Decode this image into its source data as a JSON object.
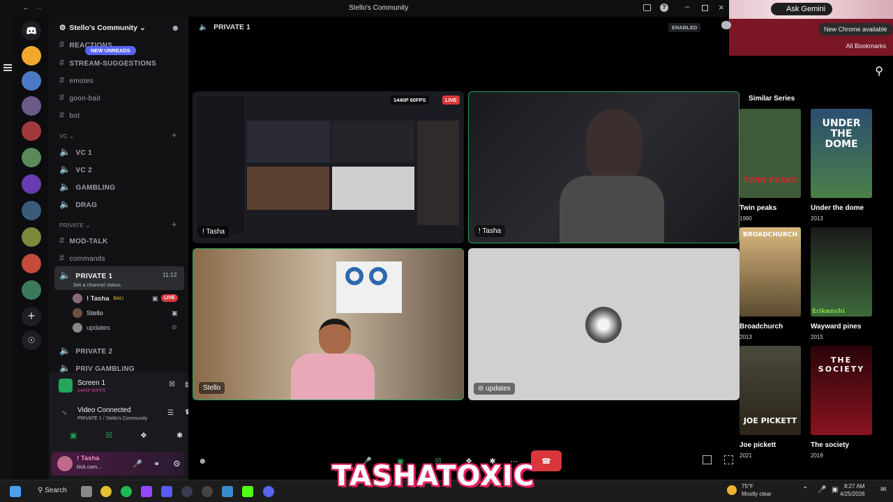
{
  "window": {
    "title": "Stello's Community"
  },
  "server": {
    "name": "Stello's Community",
    "new_unreads": "NEW UNREADS"
  },
  "channels": {
    "top": [
      "REACTIONS",
      "STREAM-SUGGESTIONS",
      "emotes",
      "goon-bait",
      "bot"
    ],
    "vc_category": "VC",
    "vc": [
      "VC 1",
      "VC 2",
      "GAMBLING",
      "DRAG"
    ],
    "private_category": "PRIVATE",
    "private_text": [
      "MOD-TALK",
      "commands"
    ],
    "private1": {
      "name": "PRIVATE 1",
      "time": "11:12",
      "status": "Set a channel status"
    },
    "voice_users": [
      {
        "name": "! Tasha",
        "badge": "BAU",
        "live": "LIVE"
      },
      {
        "name": "Stello"
      },
      {
        "name": "updates"
      }
    ],
    "after": [
      "PRIVATE 2",
      "PRIV GAMBLING"
    ]
  },
  "panel": {
    "screen_title": "Screen 1",
    "screen_sub": "1440P 60FPS",
    "video_connected": "Video Connected",
    "video_sub": "PRIVATE 1 / Stello's Community",
    "user_name": "! Tasha",
    "user_sub": "kick.com..."
  },
  "main": {
    "channel": "PRIVATE 1",
    "enabled": "ENABLED",
    "stream_badge": "1440P 60FPS",
    "live": "LIVE",
    "tiles": {
      "tl": "! Tasha",
      "tr": "! Tasha",
      "bl": "Stello",
      "br": "updates"
    }
  },
  "chrome": {
    "ask_gemini": "Ask Gemini",
    "new_chrome": "New Chrome available",
    "bookmarks": "All Bookmarks",
    "similar": "Similar Series",
    "shows": [
      {
        "name": "Twin peaks",
        "year": "1990",
        "poster": "TWIN PEAKS",
        "color": "#3f5a3a"
      },
      {
        "name": "Under the dome",
        "year": "2013",
        "poster": "UNDER THE DOME",
        "color": "#355b80"
      },
      {
        "name": "Broadchurch",
        "year": "2013",
        "poster": "BROADCHURCH",
        "color": "#c9a56a"
      },
      {
        "name": "Wayward pines",
        "year": "2015",
        "poster": "",
        "color": "#2e4a30"
      },
      {
        "name": "Joe pickett",
        "year": "2021",
        "poster": "JOE PICKETT",
        "color": "#3a3428"
      },
      {
        "name": "The society",
        "year": "2019",
        "poster": "THE SOCIETY",
        "color": "#5a0c12"
      }
    ],
    "watermark": "Erikenshi"
  },
  "taskbar": {
    "search": "Search",
    "weather_temp": "75°F",
    "weather_desc": "Mostly clear",
    "time": "8:27 AM",
    "date": "4/25/2026"
  },
  "overlay": {
    "text": "TASHATOXIC"
  }
}
